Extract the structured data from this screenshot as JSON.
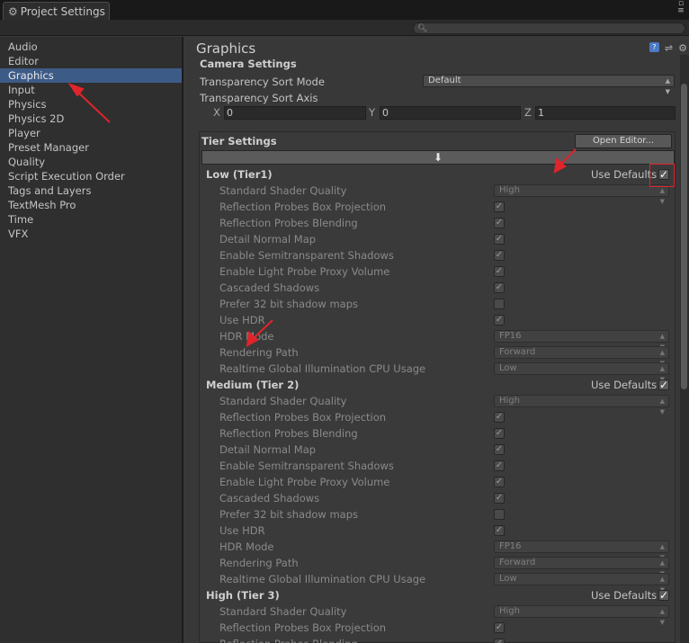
{
  "window": {
    "tab_title": "Project Settings"
  },
  "search": {
    "placeholder": ""
  },
  "sidebar": {
    "items": [
      {
        "label": "Audio"
      },
      {
        "label": "Editor"
      },
      {
        "label": "Graphics",
        "selected": true
      },
      {
        "label": "Input"
      },
      {
        "label": "Physics"
      },
      {
        "label": "Physics 2D"
      },
      {
        "label": "Player"
      },
      {
        "label": "Preset Manager"
      },
      {
        "label": "Quality"
      },
      {
        "label": "Script Execution Order"
      },
      {
        "label": "Tags and Layers"
      },
      {
        "label": "TextMesh Pro"
      },
      {
        "label": "Time"
      },
      {
        "label": "VFX"
      }
    ]
  },
  "main": {
    "title": "Graphics",
    "camera": {
      "header": "Camera Settings",
      "sort_mode_label": "Transparency Sort Mode",
      "sort_mode_value": "Default",
      "sort_axis_label": "Transparency Sort Axis",
      "x_label": "X",
      "x_value": "0",
      "y_label": "Y",
      "y_value": "0",
      "z_label": "Z",
      "z_value": "1"
    },
    "tier": {
      "header": "Tier Settings",
      "open_editor": "Open Editor...",
      "download_glyph": "⬇",
      "use_defaults": "Use Defaults",
      "tiers": [
        {
          "name": "Low (Tier1)"
        },
        {
          "name": "Medium (Tier 2)"
        },
        {
          "name": "High (Tier 3)"
        }
      ],
      "props": {
        "shader_quality": "Standard Shader Quality",
        "box_projection": "Reflection Probes Box Projection",
        "blending": "Reflection Probes Blending",
        "detail_normal": "Detail Normal Map",
        "semitransparent": "Enable Semitransparent Shadows",
        "light_probe": "Enable Light Probe Proxy Volume",
        "cascaded": "Cascaded Shadows",
        "prefer32": "Prefer 32 bit shadow maps",
        "use_hdr": "Use HDR",
        "hdr_mode": "HDR Mode",
        "render_path": "Rendering Path",
        "gi_cpu": "Realtime Global Illumination CPU Usage"
      },
      "values": {
        "high": "High",
        "fp16": "FP16",
        "forward": "Forward",
        "low": "Low"
      }
    }
  },
  "colors": {
    "selection": "#3d5b87",
    "annotation_red": "#e0242b"
  }
}
